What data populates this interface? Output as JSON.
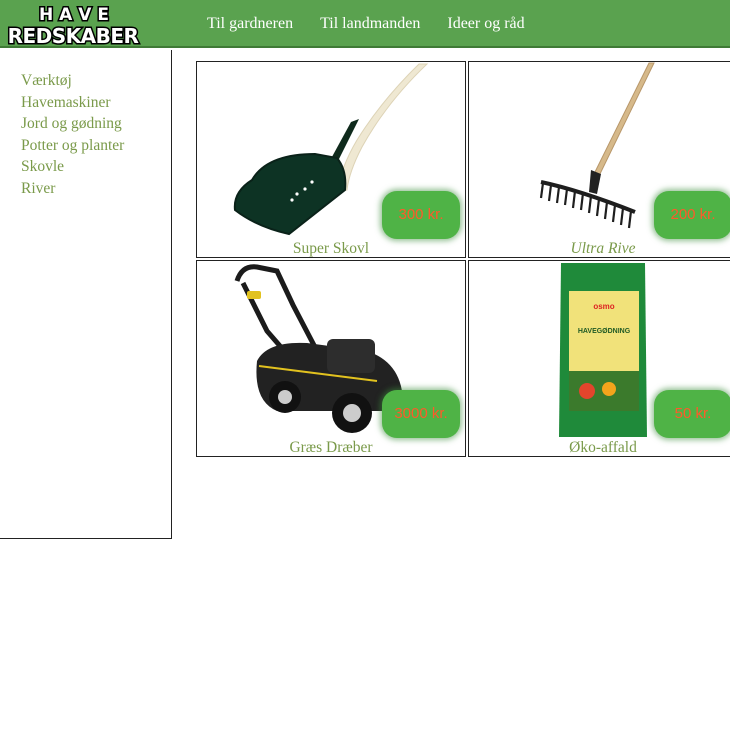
{
  "header": {
    "logo_text": "HAVE REDSKABER",
    "nav": [
      "Til gardneren",
      "Til landmanden",
      "Ideer og råd"
    ]
  },
  "sidebar": {
    "items": [
      "Værktøj",
      "Havemaskiner",
      "Jord og gødning",
      "Potter og planter",
      "Skovle",
      "River"
    ]
  },
  "products": [
    {
      "name": "Super Skovl",
      "price": "300 kr."
    },
    {
      "name": "Ultra Rive",
      "price": "200 kr."
    },
    {
      "name": "Græs Dræber",
      "price": "3000 kr."
    },
    {
      "name": "Øko-affald",
      "price": "50 kr."
    }
  ],
  "colors": {
    "header_bg": "#5aa24f",
    "link_green": "#7a9a4a",
    "price_bg": "#4fb346",
    "price_text": "#ff5a2a"
  }
}
